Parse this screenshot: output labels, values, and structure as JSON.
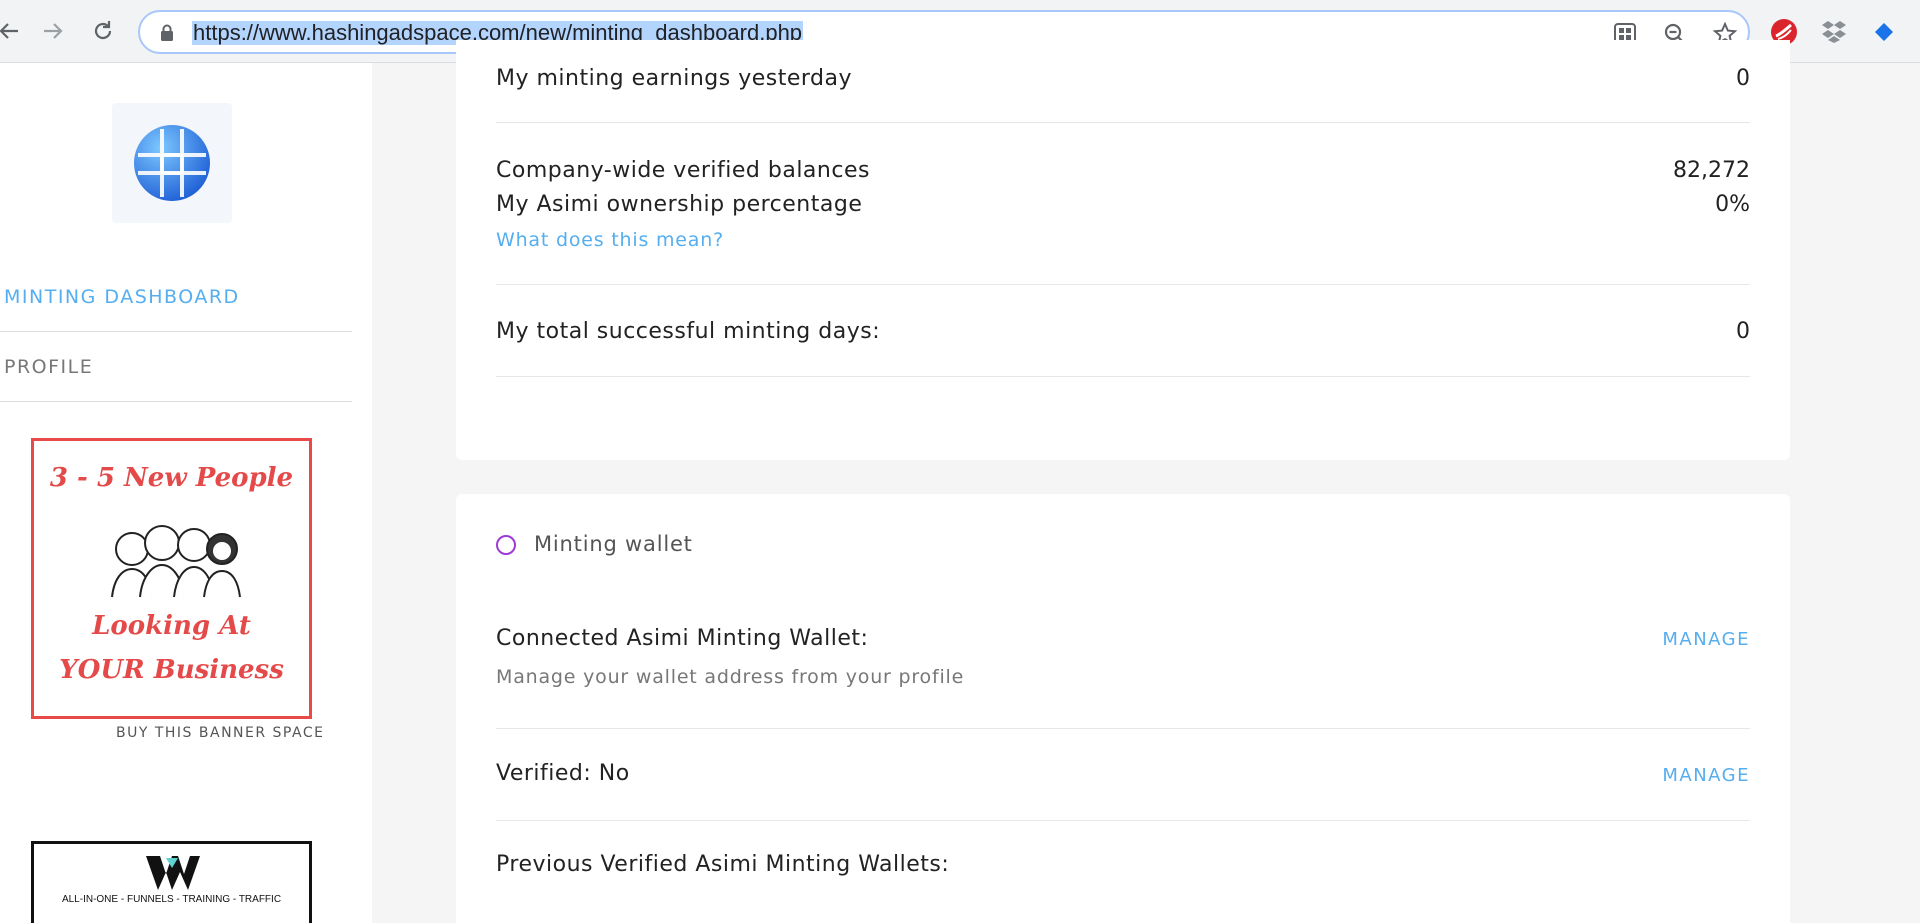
{
  "browser": {
    "url": "https://www.hashingadspace.com/new/minting_dashboard.php",
    "icons": [
      "back-arrow-icon",
      "forward-arrow-icon",
      "reload-icon",
      "lock-icon",
      "qr-code-icon",
      "zoom-out-icon",
      "star-icon",
      "extension-red-icon",
      "dropbox-icon",
      "extension-blue-diamond-icon"
    ]
  },
  "sidebar": {
    "menu": [
      {
        "label": "MINTING DASHBOARD",
        "active": true
      },
      {
        "label": "PROFILE",
        "active": false
      }
    ],
    "banner1": {
      "line1": "3 - 5 New People",
      "line2": "Looking At",
      "line3": "YOUR Business"
    },
    "buy_banner_label": "BUY THIS BANNER SPACE",
    "banner2": {
      "tagline": "ALL-IN-ONE - FUNNELS - TRAINING - TRAFFIC"
    }
  },
  "stats": {
    "earnings_label": "My minting earnings yesterday",
    "earnings_value": "0",
    "company_balances_label": "Company-wide verified balances",
    "company_balances_value": "82,272",
    "ownership_label": "My Asimi ownership percentage",
    "ownership_value": "0%",
    "what_link": "What does this mean?",
    "total_days_label": "My total successful minting days:",
    "total_days_value": "0"
  },
  "wallet": {
    "title": "Minting wallet",
    "connected_label": "Connected Asimi Minting Wallet:",
    "connected_sub": "Manage your wallet address from your profile",
    "manage1": "MANAGE",
    "verified_label": "Verified: No",
    "manage2": "MANAGE",
    "previous_label": "Previous Verified Asimi Minting Wallets:"
  },
  "colors": {
    "accent": "#55aef0",
    "banner_red": "#e44a4a",
    "ring_purple": "#9d3bd6"
  }
}
